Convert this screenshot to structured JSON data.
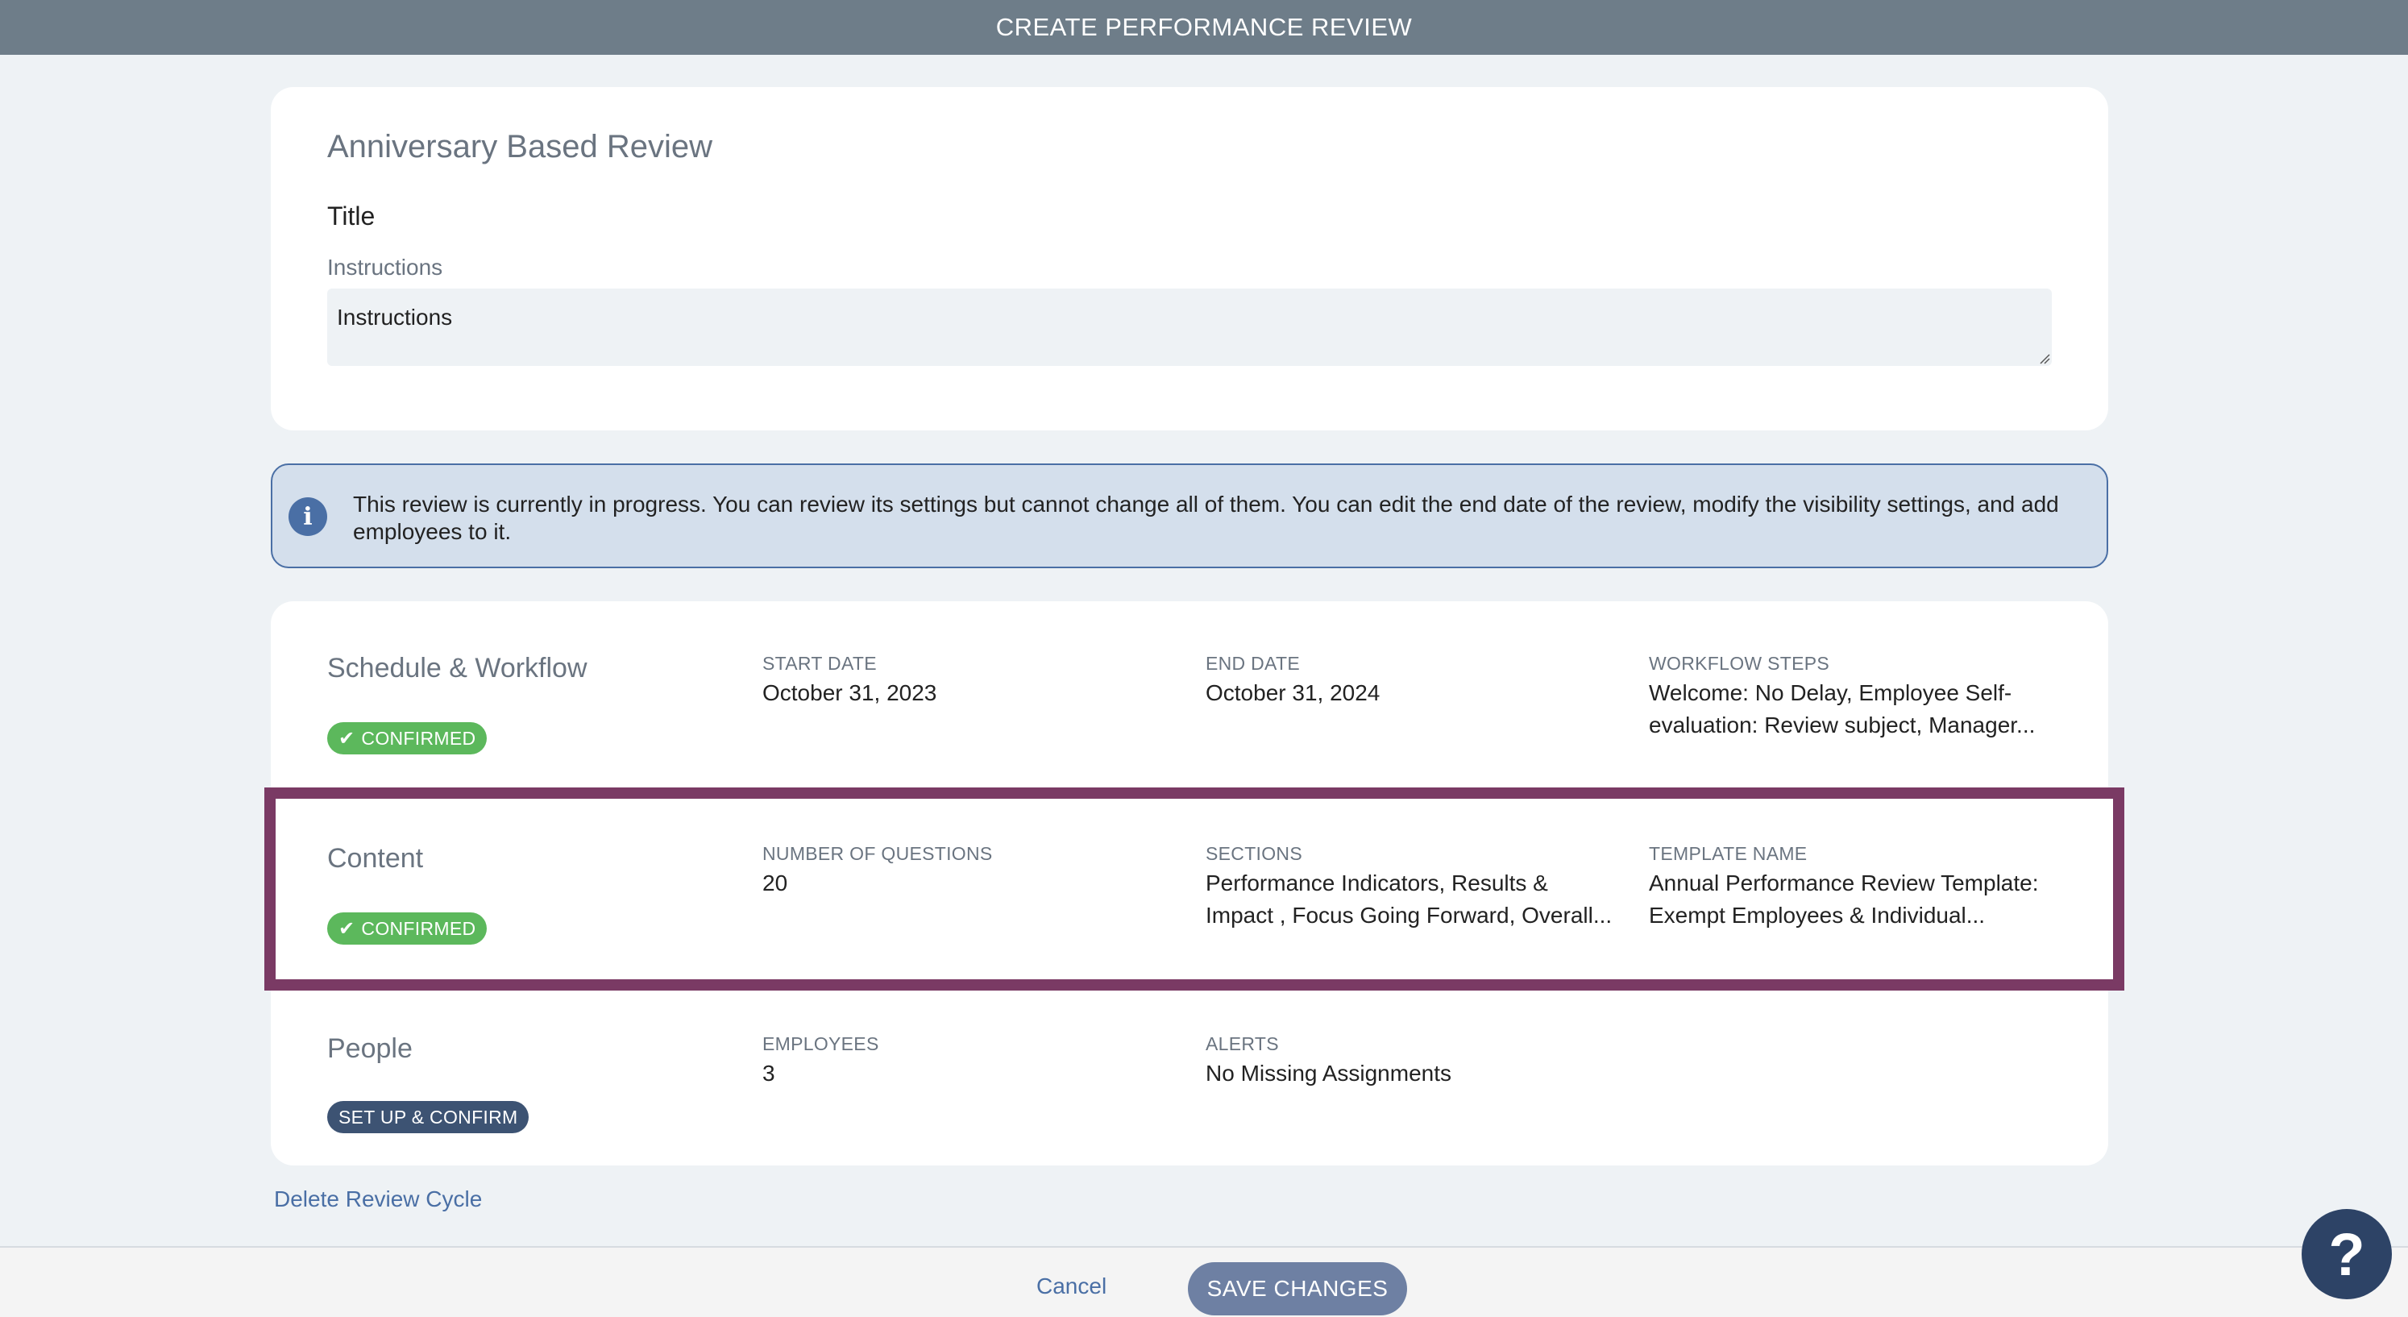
{
  "header": {
    "title": "CREATE PERFORMANCE REVIEW"
  },
  "review": {
    "name": "Anniversary Based Review",
    "title_label": "Title",
    "instructions_label": "Instructions",
    "instructions_placeholder": "Instructions"
  },
  "notice": {
    "text": "This review is currently in progress. You can review its settings but cannot change all of them. You can edit the end date of the review, modify the visibility settings, and add employees to it."
  },
  "schedule": {
    "title": "Schedule & Workflow",
    "badge": "CONFIRMED",
    "start_label": "START DATE",
    "start_value": "October 31, 2023",
    "end_label": "END DATE",
    "end_value": "October 31, 2024",
    "workflow_label": "WORKFLOW STEPS",
    "workflow_value": "Welcome: No Delay, Employee Self-evaluation: Review subject, Manager..."
  },
  "content": {
    "title": "Content",
    "badge": "CONFIRMED",
    "questions_label": "NUMBER OF QUESTIONS",
    "questions_value": "20",
    "sections_label": "SECTIONS",
    "sections_value": "Performance Indicators, Results & Impact , Focus Going Forward, Overall...",
    "template_label": "TEMPLATE NAME",
    "template_value": "Annual Performance Review Template: Exempt Employees & Individual..."
  },
  "people": {
    "title": "People",
    "badge": "SET UP & CONFIRM",
    "employees_label": "EMPLOYEES",
    "employees_value": "3",
    "alerts_label": "ALERTS",
    "alerts_value": "No Missing Assignments"
  },
  "actions": {
    "delete": "Delete Review Cycle",
    "cancel": "Cancel",
    "save": "SAVE CHANGES",
    "help": "?"
  },
  "colors": {
    "header_bg": "#6e7d89",
    "confirmed": "#5cb85c",
    "setup": "#3d5373",
    "highlight": "#7a3a64",
    "link": "#4a6fa5"
  }
}
